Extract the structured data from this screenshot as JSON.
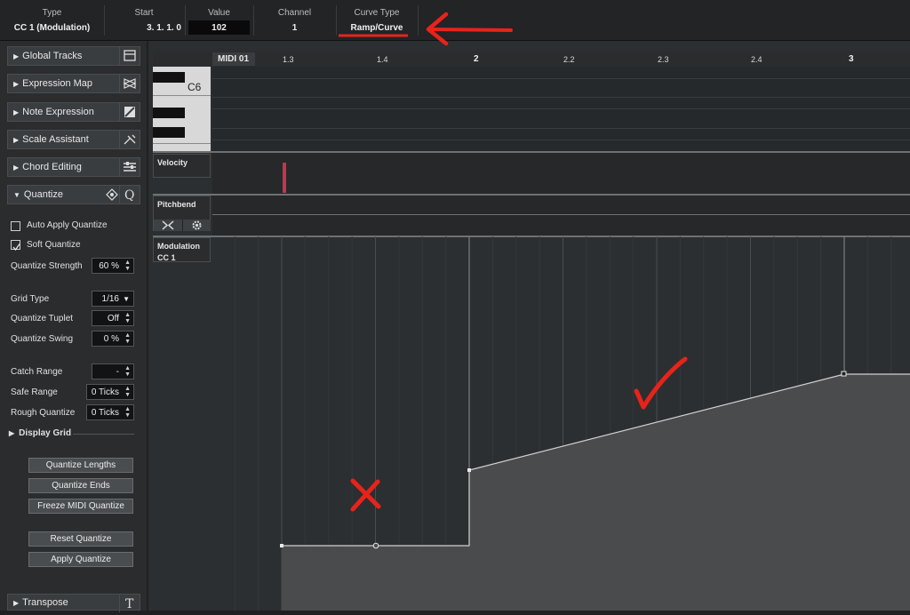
{
  "info_line": {
    "type": {
      "label": "Type",
      "value": "CC 1  (Modulation)"
    },
    "start": {
      "label": "Start",
      "value": "3.  1.  1.    0"
    },
    "value": {
      "label": "Value",
      "value": "102"
    },
    "channel": {
      "label": "Channel",
      "value": "1"
    },
    "curve_type": {
      "label": "Curve Type",
      "value": "Ramp/Curve"
    }
  },
  "inspector": {
    "sections": [
      {
        "label": "Global Tracks",
        "icon": "global-tracks-icon"
      },
      {
        "label": "Expression Map",
        "icon": "expression-map-icon"
      },
      {
        "label": "Note Expression",
        "icon": "note-expression-icon"
      },
      {
        "label": "Scale Assistant",
        "icon": "scale-assistant-icon"
      },
      {
        "label": "Chord Editing",
        "icon": "chord-editing-icon"
      },
      {
        "label": "Quantize",
        "icon": "quantize-icon"
      }
    ],
    "quantize": {
      "auto_apply": {
        "label": "Auto Apply Quantize",
        "checked": false
      },
      "soft": {
        "label": "Soft Quantize",
        "checked": true
      },
      "strength": {
        "label": "Quantize Strength",
        "value": "60 %"
      },
      "grid_type": {
        "label": "Grid Type",
        "value": "1/16"
      },
      "tuplet": {
        "label": "Quantize Tuplet",
        "value": "Off"
      },
      "swing": {
        "label": "Quantize Swing",
        "value": "0 %"
      },
      "catch_range": {
        "label": "Catch Range",
        "value": "-"
      },
      "safe_range": {
        "label": "Safe Range",
        "value": "0 Ticks"
      },
      "rough": {
        "label": "Rough Quantize",
        "value": "0 Ticks"
      },
      "display_grid": "Display Grid",
      "buttons": [
        "Quantize Lengths",
        "Quantize Ends",
        "Freeze MIDI Quantize",
        "Reset Quantize",
        "Apply Quantize"
      ]
    },
    "transpose": "Transpose"
  },
  "editor": {
    "track_name": "MIDI 01",
    "ruler_labels": [
      "1.3",
      "1.4",
      "2",
      "2.2",
      "2.3",
      "2.4",
      "3"
    ],
    "keyboard_note": "C6",
    "lanes": {
      "velocity": "Velocity",
      "pitchbend": "Pitchbend",
      "modulation": "Modulation\nCC 1"
    }
  },
  "colors": {
    "annotation_red": "#e8231a",
    "velocity_bar": "#b33d52",
    "curve_fill": "#4a4b4c"
  }
}
